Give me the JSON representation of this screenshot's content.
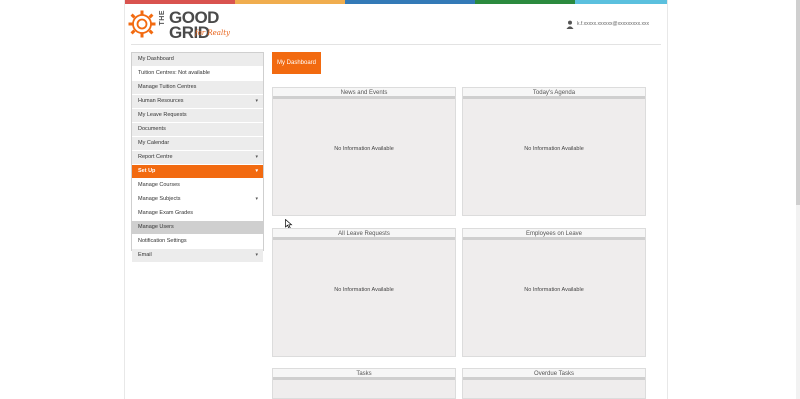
{
  "brand": {
    "the": "THE",
    "word1": "GOOD",
    "word2": "GRID",
    "tagline": "for Realty",
    "colors": {
      "orange": "#f26a10",
      "dark": "#4a4a4a"
    }
  },
  "topbar_colors": [
    "#d9534f",
    "#f0ad4e",
    "#337ab7",
    "#2b8a3e",
    "#5bc0de"
  ],
  "user": {
    "email": "k.f.xxxxx.xxxxxx@xxxxxxxxx.xxx"
  },
  "sidebar": {
    "items": [
      {
        "label": "My Dashboard",
        "caret": ""
      },
      {
        "label": "Tuition Centres: Not available",
        "caret": ""
      },
      {
        "label": "Manage Tuition Centres",
        "caret": ""
      },
      {
        "label": "Human Resources",
        "caret": "▾"
      },
      {
        "label": "My Leave Requests",
        "caret": ""
      },
      {
        "label": "Documents",
        "caret": ""
      },
      {
        "label": "My Calendar",
        "caret": ""
      },
      {
        "label": "Report Centre",
        "caret": "▾"
      },
      {
        "label": "Set Up",
        "caret": "▾"
      },
      {
        "label": "Manage Courses",
        "caret": ""
      },
      {
        "label": "Manage Subjects",
        "caret": "▾"
      },
      {
        "label": "Manage Exam Grades",
        "caret": ""
      },
      {
        "label": "Manage Users",
        "caret": ""
      },
      {
        "label": "Notification Settings",
        "caret": ""
      },
      {
        "label": "Email",
        "caret": "▾"
      }
    ]
  },
  "dashboard_tab": "My Dashboard",
  "panels": [
    {
      "title": "News and Events",
      "empty": "No Information Available"
    },
    {
      "title": "Today's Agenda",
      "empty": "No Information Available"
    },
    {
      "title": "All Leave Requests",
      "empty": "No Information Available"
    },
    {
      "title": "Employees on Leave",
      "empty": "No Information Available"
    },
    {
      "title": "Tasks",
      "empty": ""
    },
    {
      "title": "Overdue Tasks",
      "empty": ""
    }
  ]
}
